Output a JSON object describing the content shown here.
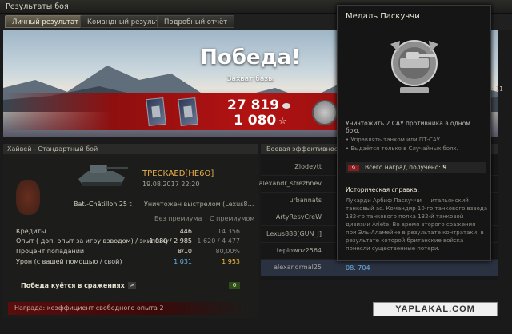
{
  "window": {
    "title": "Результаты боя",
    "close": "×",
    "timer": "ия: 11"
  },
  "tabs": [
    {
      "label": "Личный результат",
      "active": true
    },
    {
      "label": "Командный результат",
      "active": false
    },
    {
      "label": "Подробный отчёт",
      "active": false
    }
  ],
  "banner": {
    "result": "Победа!",
    "subtitle": "Захват базы",
    "credits": "27 819",
    "xp": "1 080",
    "star_icon": "☆"
  },
  "info": {
    "header": "Хайвей - Стандартный бой",
    "player": "ТРЕСКАЕD[НЕ6О]",
    "date": "19.08.2017 22:20",
    "tank": "Bat.-Châtillon 25 t",
    "killed_by": "Уничтожен выстрелом (Lexus88..)"
  },
  "stats": {
    "col_no_premium": "Без премиума",
    "col_premium": "С премиумом",
    "rows": [
      {
        "label": "Кредиты",
        "v1": "446",
        "v2": "14 356"
      },
      {
        "label": "Опыт (   доп. опыт за игру взводом) / экипажу",
        "v1": "1 080 / 2 985",
        "v2": "1 620 / 4 477"
      },
      {
        "label": "Процент попаданий",
        "v1": "8/10",
        "v2": "80,00%"
      },
      {
        "label": "Урон (с вашей помощью / свой)",
        "v1": "1 031",
        "v2": "1 953"
      }
    ]
  },
  "campaign": {
    "label": "Победа куётся в сражениях",
    "arrow": ">",
    "badge": "0"
  },
  "award": "Награда:   коэффициент свободного опыта 2",
  "team": {
    "header": "Боевая эффективность",
    "players": [
      "Ziodeytt",
      "alexandr_strezhnev",
      "urbannats",
      "ArtyResvCreW",
      "Lexus888[GUN_J]",
      "teplowoz2564",
      "alexandrmal25"
    ],
    "footer_value": "08. 704"
  },
  "tooltip": {
    "title": "Медаль Паскуччи",
    "description": "Уничтожить 2 САУ противника в одном бою.",
    "conditions": [
      "Управлять танком или ПТ-САУ.",
      "Выдаётся только в Случайных боях."
    ],
    "count_label": "Всего наград получено:",
    "count": "9",
    "count_badge": "9",
    "history_title": "Историческая справка:",
    "history": "Лукарди Арбиф Паскуччи — итальянский танковый ас. Командир 10-го танкового взвода 132-го танкового полка 132-й танковой дивизии Ariete. Во время второго сражения при Эль-Аламейне в результате контратаки, в результате которой британские войска понесли существенные потери."
  },
  "watermark": "YAPLAKAL.COM",
  "colors": {
    "accent_red": "#b31212",
    "player_name": "#e8b04a",
    "blue_value": "#6ab4e8",
    "gold_value": "#f0c040"
  }
}
